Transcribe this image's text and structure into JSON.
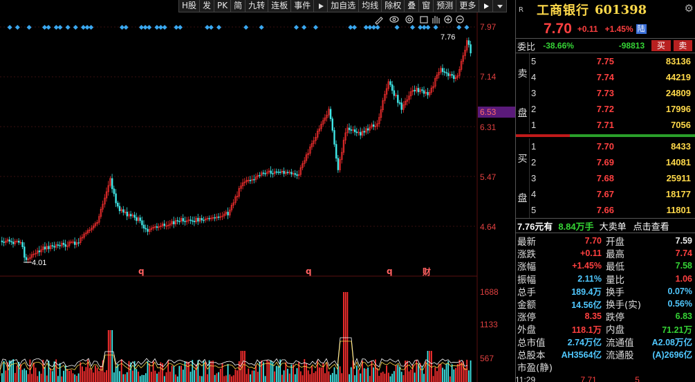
{
  "toolbar": {
    "items": [
      "H股",
      "发",
      "PK",
      "简",
      "九转",
      "连板",
      "事件",
      "加自选",
      "均线",
      "除权",
      "叠",
      "窗",
      "预测",
      "更多"
    ],
    "icons": [
      "pencil-icon",
      "eye-icon",
      "cog-icon",
      "box-icon",
      "hand-icon",
      "plus-circle-icon",
      "minus-circle-icon",
      "play-icon",
      "dropdown-icon"
    ]
  },
  "axis": {
    "price_ticks": [
      "7.97",
      "7.14",
      "6.31",
      "5.47",
      "4.64"
    ],
    "volume_ticks": [
      "1688",
      "1133",
      "567"
    ],
    "current_price_label": "6.53",
    "high_marker": "7.76",
    "low_marker": "4.01",
    "event_marks": [
      "q",
      "q",
      "q",
      "财"
    ]
  },
  "colors": {
    "up": "#ff4040",
    "down": "#35d435",
    "accent": "#ffd94a",
    "highlight": "#5a1a7a"
  },
  "quote": {
    "rmark": "R",
    "name": "工商银行",
    "code": "601398",
    "price": "7.70",
    "change": "+0.11",
    "change_pct": "+1.45%",
    "market_tag": "陆"
  },
  "weibi": {
    "label": "委比",
    "ratio": "-38.66%",
    "diff": "-98813",
    "btn_sell1": "买",
    "btn_sell2": "卖"
  },
  "book": {
    "sell_label": "卖盘",
    "buy_label": "买盘",
    "asks": [
      {
        "lvl": "5",
        "price": "7.75",
        "vol": "83136"
      },
      {
        "lvl": "4",
        "price": "7.74",
        "vol": "44219"
      },
      {
        "lvl": "3",
        "price": "7.73",
        "vol": "24809"
      },
      {
        "lvl": "2",
        "price": "7.72",
        "vol": "17996"
      },
      {
        "lvl": "1",
        "price": "7.71",
        "vol": "7056"
      }
    ],
    "bids": [
      {
        "lvl": "1",
        "price": "7.70",
        "vol": "8433"
      },
      {
        "lvl": "2",
        "price": "7.69",
        "vol": "14081"
      },
      {
        "lvl": "3",
        "price": "7.68",
        "vol": "25911"
      },
      {
        "lvl": "4",
        "price": "7.67",
        "vol": "18177"
      },
      {
        "lvl": "5",
        "price": "7.66",
        "vol": "11801"
      }
    ]
  },
  "bigorder": {
    "price": "7.76元有",
    "amount": "8.84万手",
    "label": "大卖单",
    "action": "点击查看"
  },
  "stats": [
    {
      "l1": "最新",
      "v1": "7.70",
      "c1": "red",
      "l2": "开盘",
      "v2": "7.59",
      "c2": "wht"
    },
    {
      "l1": "涨跌",
      "v1": "+0.11",
      "c1": "red",
      "l2": "最高",
      "v2": "7.74",
      "c2": "red"
    },
    {
      "l1": "涨幅",
      "v1": "+1.45%",
      "c1": "red",
      "l2": "最低",
      "v2": "7.58",
      "c2": "grn"
    },
    {
      "l1": "振幅",
      "v1": "2.11%",
      "c1": "blu",
      "l2": "量比",
      "v2": "1.06",
      "c2": "red"
    },
    {
      "l1": "总手",
      "v1": "189.4万",
      "c1": "blu",
      "l2": "换手",
      "v2": "0.07%",
      "c2": "blu"
    },
    {
      "l1": "金额",
      "v1": "14.56亿",
      "c1": "blu",
      "l2": "换手(实)",
      "v2": "0.56%",
      "c2": "blu"
    },
    {
      "l1": "涨停",
      "v1": "8.35",
      "c1": "red",
      "l2": "跌停",
      "v2": "6.83",
      "c2": "grn"
    },
    {
      "l1": "外盘",
      "v1": "118.1万",
      "c1": "red",
      "l2": "内盘",
      "v2": "71.21万",
      "c2": "grn"
    },
    {
      "l1": "总市值",
      "v1": "2.74万亿",
      "c1": "blu",
      "l2": "流通值",
      "v2": "A2.08万亿",
      "c2": "blu"
    },
    {
      "l1": "总股本",
      "v1": "AH3564亿",
      "c1": "blu",
      "l2": "流通股",
      "v2": "(A)2696亿",
      "c2": "blu"
    },
    {
      "l1": "市盈(静)",
      "v1": "",
      "c1": "blu",
      "l2": "",
      "v2": "",
      "c2": "blu"
    }
  ],
  "footer": {
    "time": "11:29",
    "price": "7.71",
    "vol": "5"
  }
}
